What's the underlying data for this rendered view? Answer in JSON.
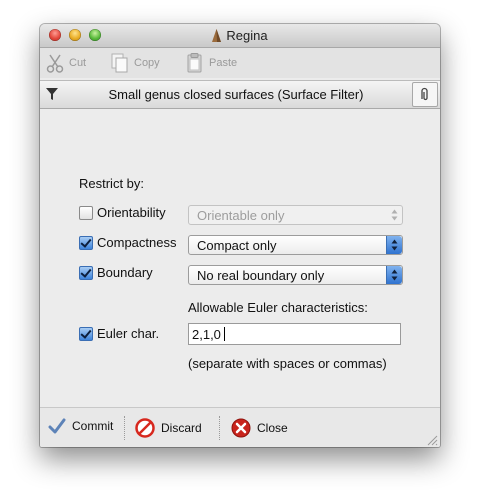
{
  "window": {
    "title": "Regina",
    "title_icon": "regina-pyramid-icon"
  },
  "toolbar": {
    "cut_label": "Cut",
    "copy_label": "Copy",
    "paste_label": "Paste"
  },
  "filter_header": {
    "title": "Small genus closed surfaces (Surface Filter)",
    "icons": [
      "filter-funnel-icon",
      "paperclip-icon"
    ]
  },
  "form": {
    "restrict_label": "Restrict by:",
    "orientability": {
      "label": "Orientability",
      "checked": false,
      "value": "Orientable only"
    },
    "compactness": {
      "label": "Compactness",
      "checked": true,
      "value": "Compact only"
    },
    "boundary": {
      "label": "Boundary",
      "checked": true,
      "value": "No real boundary only"
    },
    "euler_heading": "Allowable Euler characteristics:",
    "euler": {
      "label": "Euler char.",
      "checked": true,
      "value": "2,1,0"
    },
    "euler_hint": "(separate with spaces or commas)"
  },
  "actions": {
    "commit_label": "Commit",
    "discard_label": "Discard",
    "close_label": "Close"
  },
  "colors": {
    "accent": "#3e84db",
    "discard_red": "#d7281e",
    "close_red": "#c8241c"
  }
}
